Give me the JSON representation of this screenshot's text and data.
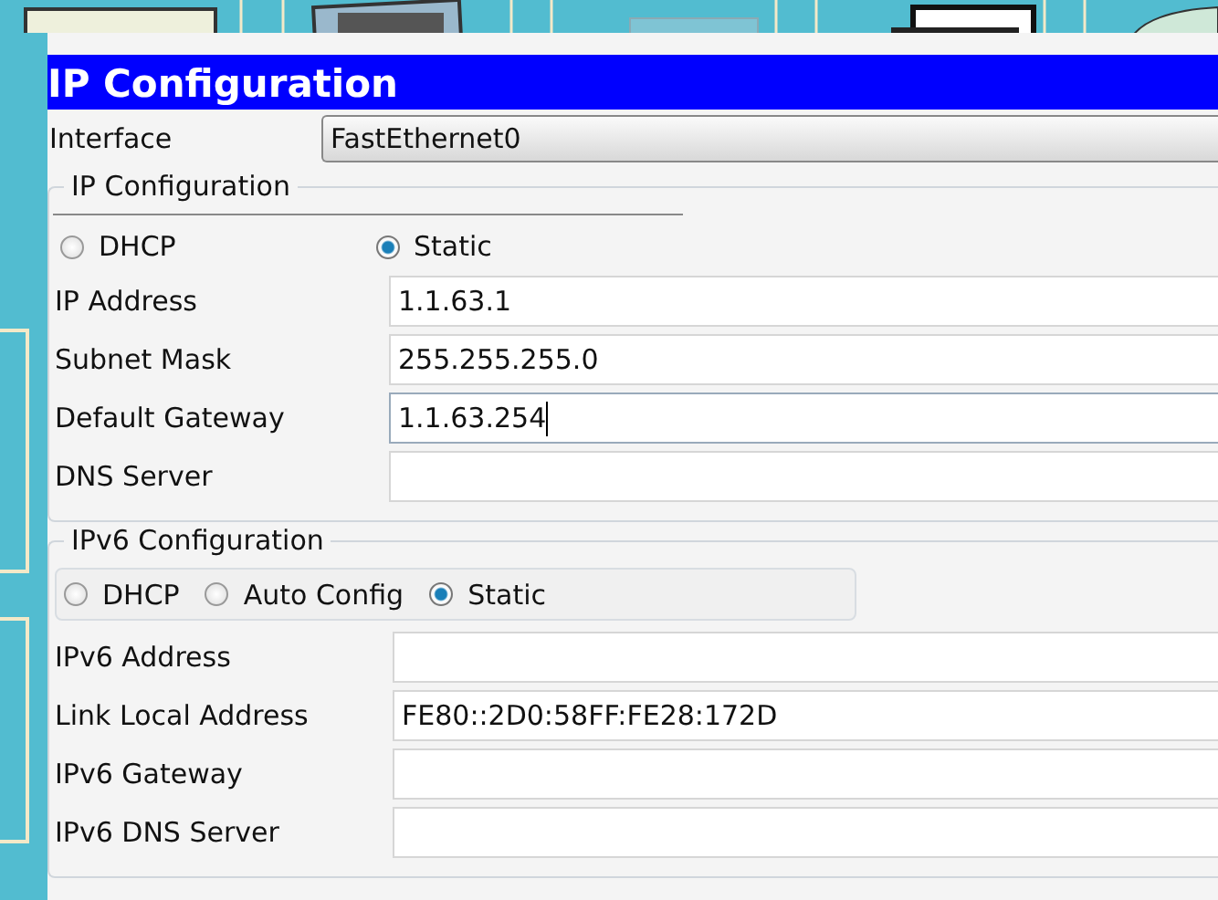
{
  "title": "IP Configuration",
  "interface": {
    "label": "Interface",
    "value": "FastEthernet0"
  },
  "ipv4": {
    "legend": "IP Configuration",
    "modes": [
      {
        "label": "DHCP",
        "selected": false
      },
      {
        "label": "Static",
        "selected": true
      }
    ],
    "fields": [
      {
        "label": "IP Address",
        "value": "1.1.63.1",
        "focused": false
      },
      {
        "label": "Subnet Mask",
        "value": "255.255.255.0",
        "focused": false
      },
      {
        "label": "Default Gateway",
        "value": "1.1.63.254",
        "focused": true
      },
      {
        "label": "DNS Server",
        "focused": false
      }
    ]
  },
  "ipv6": {
    "legend": "IPv6 Configuration",
    "modes": [
      {
        "label": "DHCP",
        "selected": false
      },
      {
        "label": "Auto Config",
        "selected": false
      },
      {
        "label": "Static",
        "selected": true
      }
    ],
    "fields": [
      {
        "label": "IPv6 Address",
        "focused": false
      },
      {
        "label": "Link Local Address",
        "value": "FE80::2D0:58FF:FE28:172D",
        "focused": false
      },
      {
        "label": "IPv6 Gateway",
        "focused": false
      },
      {
        "label": "IPv6 DNS Server",
        "focused": false
      }
    ]
  }
}
